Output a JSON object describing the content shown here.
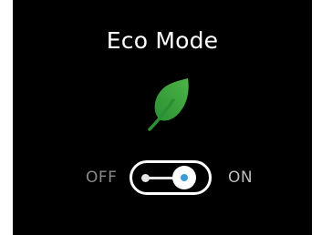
{
  "title": "Eco Mode",
  "icon": {
    "name": "leaf-icon",
    "color": "#2ea03a"
  },
  "toggle": {
    "off_label": "OFF",
    "on_label": "ON",
    "state": "on",
    "accent": "#3a9bd9"
  }
}
